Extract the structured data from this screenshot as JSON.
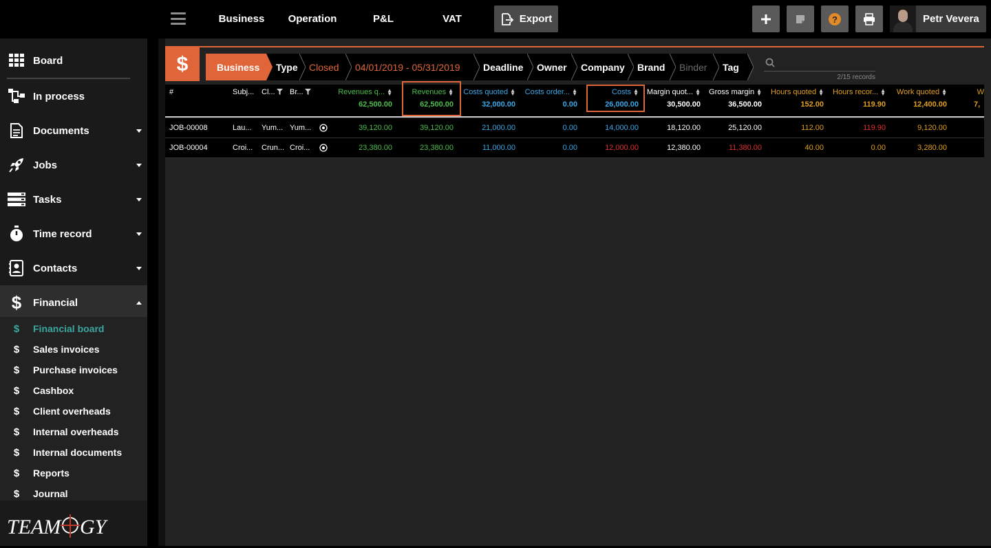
{
  "top_tabs": [
    {
      "label": "Business",
      "active": true
    },
    {
      "label": "Operation",
      "active": false
    },
    {
      "label": "P&L",
      "active": false
    },
    {
      "label": "VAT",
      "active": false
    }
  ],
  "export_label": "Export",
  "user_name": "Petr Vevera",
  "sidebar": {
    "items": [
      {
        "label": "Board",
        "icon": "grid-icon"
      },
      {
        "label": "In process",
        "icon": "workflow-icon"
      },
      {
        "label": "Documents",
        "icon": "document-icon"
      },
      {
        "label": "Jobs",
        "icon": "rocket-icon"
      },
      {
        "label": "Tasks",
        "icon": "tasks-icon"
      },
      {
        "label": "Time record",
        "icon": "stopwatch-icon"
      },
      {
        "label": "Contacts",
        "icon": "contacts-icon"
      },
      {
        "label": "Financial",
        "icon": "dollar-icon"
      }
    ],
    "financial_sub": [
      "Financial board",
      "Sales invoices",
      "Purchase invoices",
      "Cashbox",
      "Client overheads",
      "Internal overheads",
      "Internal documents",
      "Reports",
      "Journal"
    ],
    "active_sub": "Financial board",
    "logo_text": "TEAMOGY"
  },
  "filters": [
    "Business",
    "Type",
    "Closed",
    "04/01/2019 - 05/31/2019",
    "Deadline",
    "Owner",
    "Company",
    "Brand",
    "Binder",
    "Tag"
  ],
  "records": "2/15 records",
  "table": {
    "columns": [
      {
        "label": "#",
        "total": ""
      },
      {
        "label": "Subj...",
        "total": ""
      },
      {
        "label": "Cl...",
        "total": ""
      },
      {
        "label": "Br...",
        "total": ""
      },
      {
        "label": "Revenues q...",
        "total": "62,500.00"
      },
      {
        "label": "Revenues",
        "total": "62,500.00"
      },
      {
        "label": "Costs quoted",
        "total": "32,000.00"
      },
      {
        "label": "Costs order...",
        "total": "0.00"
      },
      {
        "label": "Costs",
        "total": "26,000.00"
      },
      {
        "label": "Margin quot...",
        "total": "30,500.00"
      },
      {
        "label": "Gross margin",
        "total": "36,500.00"
      },
      {
        "label": "Hours quoted",
        "total": "152.00"
      },
      {
        "label": "Hours recor...",
        "total": "119.90"
      },
      {
        "label": "Work quoted",
        "total": "12,400.00"
      },
      {
        "label": "W",
        "total": "7,"
      }
    ],
    "rows": [
      [
        "JOB-00008",
        "Lau...",
        "Yum...",
        "Yum...",
        "39,120.00",
        "39,120.00",
        "21,000.00",
        "0.00",
        "14,000.00",
        "18,120.00",
        "25,120.00",
        "112.00",
        "119.90",
        "9,120.00"
      ],
      [
        "JOB-00004",
        "Croi...",
        "Crun...",
        "Croi...",
        "23,380.00",
        "23,380.00",
        "11,000.00",
        "0.00",
        "12,000.00",
        "12,380.00",
        "11,380.00",
        "40.00",
        "0.00",
        "3,280.00"
      ]
    ]
  },
  "colors": {
    "accent": "#e0663a",
    "revenue": "#4cbe4c",
    "cost": "#3aa8e8",
    "hours": "#e0a020",
    "negative": "#e03030",
    "financial_active": "#3aa8a0"
  }
}
